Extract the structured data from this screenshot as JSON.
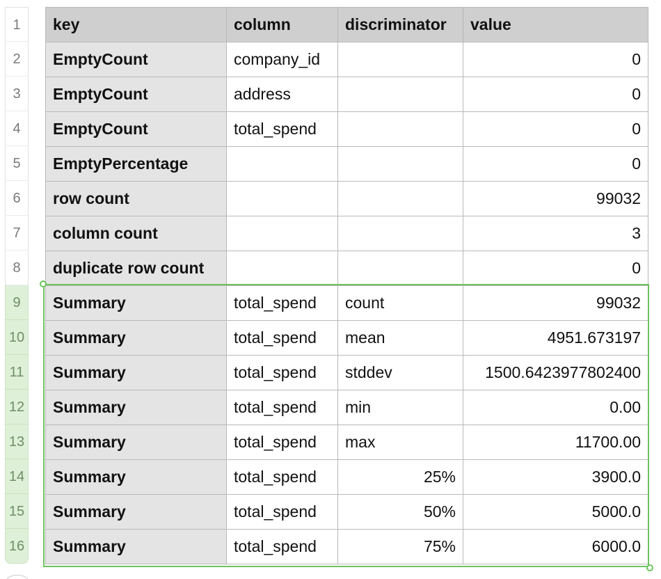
{
  "row_numbers": [
    "1",
    "2",
    "3",
    "4",
    "5",
    "6",
    "7",
    "8",
    "9",
    "10",
    "11",
    "12",
    "13",
    "14",
    "15",
    "16"
  ],
  "columns": [
    "key",
    "column",
    "discriminator",
    "value"
  ],
  "rows": [
    {
      "key": "EmptyCount",
      "column": "company_id",
      "discriminator": "",
      "value": "0"
    },
    {
      "key": "EmptyCount",
      "column": "address",
      "discriminator": "",
      "value": "0"
    },
    {
      "key": "EmptyCount",
      "column": "total_spend",
      "discriminator": "",
      "value": "0"
    },
    {
      "key": "EmptyPercentage",
      "column": "",
      "discriminator": "",
      "value": "0"
    },
    {
      "key": "row count",
      "column": "",
      "discriminator": "",
      "value": "99032"
    },
    {
      "key": "column count",
      "column": "",
      "discriminator": "",
      "value": "3"
    },
    {
      "key": "duplicate row count",
      "column": "",
      "discriminator": "",
      "value": "0"
    },
    {
      "key": "Summary",
      "column": "total_spend",
      "discriminator": "count",
      "value": "99032"
    },
    {
      "key": "Summary",
      "column": "total_spend",
      "discriminator": "mean",
      "value": "4951.673197"
    },
    {
      "key": "Summary",
      "column": "total_spend",
      "discriminator": "stddev",
      "value": "1500.6423977802400"
    },
    {
      "key": "Summary",
      "column": "total_spend",
      "discriminator": "min",
      "value": "0.00"
    },
    {
      "key": "Summary",
      "column": "total_spend",
      "discriminator": "max",
      "value": "11700.00"
    },
    {
      "key": "Summary",
      "column": "total_spend",
      "discriminator": "25%",
      "value": "3900.0"
    },
    {
      "key": "Summary",
      "column": "total_spend",
      "discriminator": "50%",
      "value": "5000.0"
    },
    {
      "key": "Summary",
      "column": "total_spend",
      "discriminator": "75%",
      "value": "6000.0"
    }
  ],
  "colors": {
    "selection": "#6cc35b",
    "selected_row_header": "#dff0d8",
    "header_fill": "#cfcfcf",
    "key_column_fill": "#e4e4e4"
  }
}
